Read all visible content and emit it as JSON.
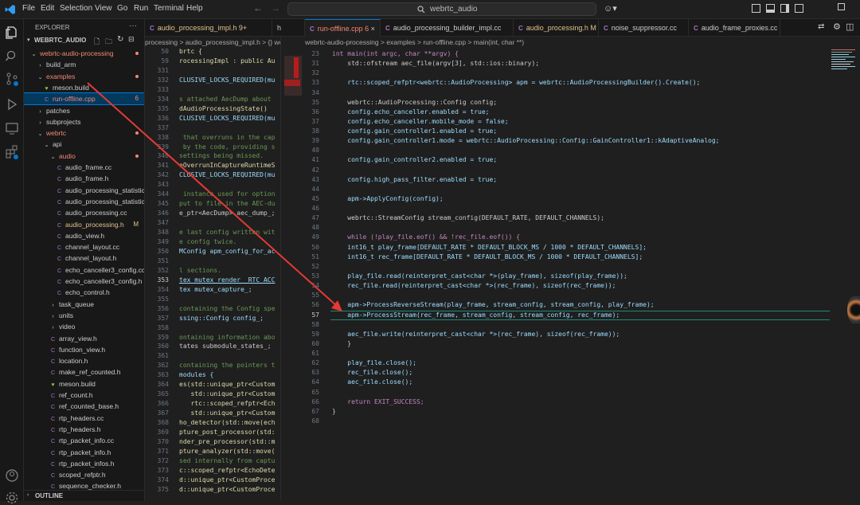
{
  "titlebar": {
    "menus": [
      "File",
      "Edit",
      "Selection",
      "View",
      "Go",
      "Run",
      "Terminal",
      "Help"
    ],
    "search": "webrtc_audio"
  },
  "sidebar": {
    "title": "EXPLORER",
    "root": "WEBRTC_AUDIO",
    "outline": "OUTLINE",
    "items": [
      {
        "label": "webrtc-audio-processing",
        "indent": 0,
        "kind": "folder-open",
        "color": "#f48771",
        "badge": "",
        "badgeColor": ""
      },
      {
        "label": "build_arm",
        "indent": 1,
        "kind": "folder",
        "color": "#cccccc",
        "badge": "",
        "badgeColor": ""
      },
      {
        "label": "examples",
        "indent": 1,
        "kind": "folder-open",
        "color": "#f48771",
        "badge": "",
        "badgeColor": ""
      },
      {
        "label": "meson.build",
        "indent": 2,
        "kind": "meson",
        "color": "#cccccc",
        "badge": "",
        "badgeColor": ""
      },
      {
        "label": "run-offline.cpp",
        "indent": 2,
        "kind": "cpp",
        "color": "#f48771",
        "badge": "6",
        "badgeColor": "#f48771"
      },
      {
        "label": "patches",
        "indent": 1,
        "kind": "folder",
        "color": "#cccccc",
        "badge": "",
        "badgeColor": ""
      },
      {
        "label": "subprojects",
        "indent": 1,
        "kind": "folder",
        "color": "#cccccc",
        "badge": "",
        "badgeColor": ""
      },
      {
        "label": "webrtc",
        "indent": 1,
        "kind": "folder-open",
        "color": "#f48771",
        "badge": "",
        "badgeColor": ""
      },
      {
        "label": "api",
        "indent": 2,
        "kind": "folder-open",
        "color": "#cccccc",
        "badge": "",
        "badgeColor": ""
      },
      {
        "label": "audio",
        "indent": 3,
        "kind": "folder-open",
        "color": "#f48771",
        "badge": "",
        "badgeColor": ""
      },
      {
        "label": "audio_frame.cc",
        "indent": 4,
        "kind": "cc",
        "color": "#cccccc",
        "badge": "",
        "badgeColor": ""
      },
      {
        "label": "audio_frame.h",
        "indent": 4,
        "kind": "h",
        "color": "#cccccc",
        "badge": "",
        "badgeColor": ""
      },
      {
        "label": "audio_processing_statistics.cc",
        "indent": 4,
        "kind": "cc",
        "color": "#cccccc",
        "badge": "",
        "badgeColor": ""
      },
      {
        "label": "audio_processing_statistics.h",
        "indent": 4,
        "kind": "h",
        "color": "#cccccc",
        "badge": "",
        "badgeColor": ""
      },
      {
        "label": "audio_processing.cc",
        "indent": 4,
        "kind": "cc",
        "color": "#cccccc",
        "badge": "",
        "badgeColor": ""
      },
      {
        "label": "audio_processing.h",
        "indent": 4,
        "kind": "h",
        "color": "#e2c08d",
        "badge": "M",
        "badgeColor": "#e2c08d"
      },
      {
        "label": "audio_view.h",
        "indent": 4,
        "kind": "h",
        "color": "#cccccc",
        "badge": "",
        "badgeColor": ""
      },
      {
        "label": "channel_layout.cc",
        "indent": 4,
        "kind": "cc",
        "color": "#cccccc",
        "badge": "",
        "badgeColor": ""
      },
      {
        "label": "channel_layout.h",
        "indent": 4,
        "kind": "h",
        "color": "#cccccc",
        "badge": "",
        "badgeColor": ""
      },
      {
        "label": "echo_canceller3_config.cc",
        "indent": 4,
        "kind": "cc",
        "color": "#cccccc",
        "badge": "",
        "badgeColor": ""
      },
      {
        "label": "echo_canceller3_config.h",
        "indent": 4,
        "kind": "h",
        "color": "#cccccc",
        "badge": "",
        "badgeColor": ""
      },
      {
        "label": "echo_control.h",
        "indent": 4,
        "kind": "h",
        "color": "#cccccc",
        "badge": "",
        "badgeColor": ""
      },
      {
        "label": "task_queue",
        "indent": 3,
        "kind": "folder",
        "color": "#cccccc",
        "badge": "",
        "badgeColor": ""
      },
      {
        "label": "units",
        "indent": 3,
        "kind": "folder",
        "color": "#cccccc",
        "badge": "",
        "badgeColor": ""
      },
      {
        "label": "video",
        "indent": 3,
        "kind": "folder",
        "color": "#cccccc",
        "badge": "",
        "badgeColor": ""
      },
      {
        "label": "array_view.h",
        "indent": 3,
        "kind": "h",
        "color": "#cccccc",
        "badge": "",
        "badgeColor": ""
      },
      {
        "label": "function_view.h",
        "indent": 3,
        "kind": "h",
        "color": "#cccccc",
        "badge": "",
        "badgeColor": ""
      },
      {
        "label": "location.h",
        "indent": 3,
        "kind": "h",
        "color": "#cccccc",
        "badge": "",
        "badgeColor": ""
      },
      {
        "label": "make_ref_counted.h",
        "indent": 3,
        "kind": "h",
        "color": "#cccccc",
        "badge": "",
        "badgeColor": ""
      },
      {
        "label": "meson.build",
        "indent": 3,
        "kind": "meson",
        "color": "#cccccc",
        "badge": "",
        "badgeColor": ""
      },
      {
        "label": "ref_count.h",
        "indent": 3,
        "kind": "h",
        "color": "#cccccc",
        "badge": "",
        "badgeColor": ""
      },
      {
        "label": "ref_counted_base.h",
        "indent": 3,
        "kind": "h",
        "color": "#cccccc",
        "badge": "",
        "badgeColor": ""
      },
      {
        "label": "rtp_headers.cc",
        "indent": 3,
        "kind": "cc",
        "color": "#cccccc",
        "badge": "",
        "badgeColor": ""
      },
      {
        "label": "rtp_headers.h",
        "indent": 3,
        "kind": "h",
        "color": "#cccccc",
        "badge": "",
        "badgeColor": ""
      },
      {
        "label": "rtp_packet_info.cc",
        "indent": 3,
        "kind": "cc",
        "color": "#cccccc",
        "badge": "",
        "badgeColor": ""
      },
      {
        "label": "rtp_packet_info.h",
        "indent": 3,
        "kind": "h",
        "color": "#cccccc",
        "badge": "",
        "badgeColor": ""
      },
      {
        "label": "rtp_packet_infos.h",
        "indent": 3,
        "kind": "h",
        "color": "#cccccc",
        "badge": "",
        "badgeColor": ""
      },
      {
        "label": "scoped_refptr.h",
        "indent": 3,
        "kind": "h",
        "color": "#cccccc",
        "badge": "",
        "badgeColor": ""
      },
      {
        "label": "sequence_checker.h",
        "indent": 3,
        "kind": "h",
        "color": "#cccccc",
        "badge": "",
        "badgeColor": ""
      }
    ]
  },
  "tabs": [
    {
      "label": "audio_processing_impl.h 9+",
      "color": "#e2c08d",
      "active": false
    },
    {
      "label": "h",
      "color": "#cccccc",
      "active": false
    },
    {
      "label": "run-offline.cpp 6",
      "color": "#f48771",
      "active": true
    },
    {
      "label": "audio_processing_builder_impl.cc",
      "color": "#cccccc",
      "active": false
    },
    {
      "label": "audio_processing.h M",
      "color": "#e2c08d",
      "active": false
    },
    {
      "label": "noise_suppressor.cc",
      "color": "#cccccc",
      "active": false
    },
    {
      "label": "audio_frame_proxies.cc",
      "color": "#cccccc",
      "active": false
    }
  ],
  "left_crumb": "processing > audio_processing_impl.h > {} web",
  "main_crumb": "webrtc-audio-processing > examples > run-offline.cpp > main(int, char **)",
  "left_code": [
    {
      "n": "50",
      "t": "brtc {"
    },
    {
      "n": "59",
      "t": "rocessingImpl : public Au"
    },
    {
      "n": "331",
      "t": ""
    },
    {
      "n": "332",
      "t": "CLUSIVE_LOCKS_REQUIRED(mu"
    },
    {
      "n": "333",
      "t": ""
    },
    {
      "n": "334",
      "t": "s attached AecDump about"
    },
    {
      "n": "335",
      "t": "dAudioProcessingState()"
    },
    {
      "n": "336",
      "t": "CLUSIVE_LOCKS_REQUIRED(mu"
    },
    {
      "n": "337",
      "t": ""
    },
    {
      "n": "338",
      "t": " that overruns in the cap"
    },
    {
      "n": "339",
      "t": " by the code, providing s"
    },
    {
      "n": "340",
      "t": "settings being missed."
    },
    {
      "n": "341",
      "t": "eOverrunInCaptureRuntimeS"
    },
    {
      "n": "342",
      "t": "CLUSIVE_LOCKS_REQUIRED(mu"
    },
    {
      "n": "343",
      "t": ""
    },
    {
      "n": "344",
      "t": " instance used for option"
    },
    {
      "n": "345",
      "t": "put to file in the AEC-du"
    },
    {
      "n": "346",
      "t": "e_ptr<AecDump> aec_dump_;"
    },
    {
      "n": "347",
      "t": ""
    },
    {
      "n": "348",
      "t": "e last config written wit"
    },
    {
      "n": "349",
      "t": "e config twice."
    },
    {
      "n": "350",
      "t": "MConfig apm_config_for_ac"
    },
    {
      "n": "351",
      "t": ""
    },
    {
      "n": "352",
      "t": "l sections."
    },
    {
      "n": "353",
      "t": "tex mutex_render_ RTC_ACC"
    },
    {
      "n": "354",
      "t": "tex mutex_capture_;"
    },
    {
      "n": "355",
      "t": ""
    },
    {
      "n": "356",
      "t": "containing the Config spe"
    },
    {
      "n": "357",
      "t": "ssing::Config config_;"
    },
    {
      "n": "358",
      "t": ""
    },
    {
      "n": "359",
      "t": "ontaining information abo"
    },
    {
      "n": "360",
      "t": "tates submodule_states_;"
    },
    {
      "n": "361",
      "t": ""
    },
    {
      "n": "362",
      "t": "containing the pointers t"
    },
    {
      "n": "363",
      "t": "modules {"
    },
    {
      "n": "364",
      "t": "es(std::unique_ptr<Custom"
    },
    {
      "n": "365",
      "t": "   std::unique_ptr<Custom"
    },
    {
      "n": "366",
      "t": "   rtc::scoped_refptr<Ech"
    },
    {
      "n": "367",
      "t": "   std::unique_ptr<Custom"
    },
    {
      "n": "368",
      "t": "ho_detector(std::move(ech"
    },
    {
      "n": "369",
      "t": "pture_post_processor(std:"
    },
    {
      "n": "370",
      "t": "nder_pre_processor(std::m"
    },
    {
      "n": "371",
      "t": "pture_analyzer(std::move("
    },
    {
      "n": "372",
      "t": "sed internally from captu"
    },
    {
      "n": "373",
      "t": "c::scoped_refptr<EchoDete"
    },
    {
      "n": "374",
      "t": "d::unique_ptr<CustomProce"
    },
    {
      "n": "375",
      "t": "d::unique_ptr<CustomProce"
    }
  ],
  "main_code": [
    {
      "n": "23",
      "t": "int main(int argc, char **argv) {"
    },
    {
      "n": "31",
      "t": "    std::ofstream aec_file(argv[3], std::ios::binary);"
    },
    {
      "n": "32",
      "t": ""
    },
    {
      "n": "33",
      "t": "    rtc::scoped_refptr<webrtc::AudioProcessing> apm = webrtc::AudioProcessingBuilder().Create();"
    },
    {
      "n": "34",
      "t": ""
    },
    {
      "n": "35",
      "t": "    webrtc::AudioProcessing::Config config;"
    },
    {
      "n": "36",
      "t": "    config.echo_canceller.enabled = true;"
    },
    {
      "n": "37",
      "t": "    config.echo_canceller.mobile_mode = false;"
    },
    {
      "n": "38",
      "t": "    config.gain_controller1.enabled = true;"
    },
    {
      "n": "39",
      "t": "    config.gain_controller1.mode = webrtc::AudioProcessing::Config::GainController1::kAdaptiveAnalog;"
    },
    {
      "n": "40",
      "t": ""
    },
    {
      "n": "41",
      "t": "    config.gain_controller2.enabled = true;"
    },
    {
      "n": "42",
      "t": ""
    },
    {
      "n": "43",
      "t": "    config.high_pass_filter.enabled = true;"
    },
    {
      "n": "44",
      "t": ""
    },
    {
      "n": "45",
      "t": "    apm->ApplyConfig(config);"
    },
    {
      "n": "46",
      "t": ""
    },
    {
      "n": "47",
      "t": "    webrtc::StreamConfig stream_config(DEFAULT_RATE, DEFAULT_CHANNELS);"
    },
    {
      "n": "48",
      "t": ""
    },
    {
      "n": "49",
      "t": "    while (!play_file.eof() && !rec_file.eof()) {"
    },
    {
      "n": "50",
      "t": "    int16_t play_frame[DEFAULT_RATE * DEFAULT_BLOCK_MS / 1000 * DEFAULT_CHANNELS];"
    },
    {
      "n": "51",
      "t": "    int16_t rec_frame[DEFAULT_RATE * DEFAULT_BLOCK_MS / 1000 * DEFAULT_CHANNELS];"
    },
    {
      "n": "52",
      "t": ""
    },
    {
      "n": "53",
      "t": "    play_file.read(reinterpret_cast<char *>(play_frame), sizeof(play_frame));"
    },
    {
      "n": "54",
      "t": "    rec_file.read(reinterpret_cast<char *>(rec_frame), sizeof(rec_frame));"
    },
    {
      "n": "55",
      "t": ""
    },
    {
      "n": "56",
      "t": "    apm->ProcessReverseStream(play_frame, stream_config, stream_config, play_frame);"
    },
    {
      "n": "57",
      "t": "    apm->ProcessStream(rec_frame, stream_config, stream_config, rec_frame);"
    },
    {
      "n": "58",
      "t": ""
    },
    {
      "n": "59",
      "t": "    aec_file.write(reinterpret_cast<char *>(rec_frame), sizeof(rec_frame));"
    },
    {
      "n": "60",
      "t": "    }"
    },
    {
      "n": "61",
      "t": ""
    },
    {
      "n": "62",
      "t": "    play_file.close();"
    },
    {
      "n": "63",
      "t": "    rec_file.close();"
    },
    {
      "n": "64",
      "t": "    aec_file.close();"
    },
    {
      "n": "65",
      "t": ""
    },
    {
      "n": "66",
      "t": "    return EXIT_SUCCESS;"
    },
    {
      "n": "67",
      "t": "}"
    },
    {
      "n": "68",
      "t": ""
    }
  ],
  "colors": {
    "accent": "#0078d4",
    "modified": "#e2c08d",
    "error": "#f48771",
    "annotation_arrow": "#e53935"
  }
}
